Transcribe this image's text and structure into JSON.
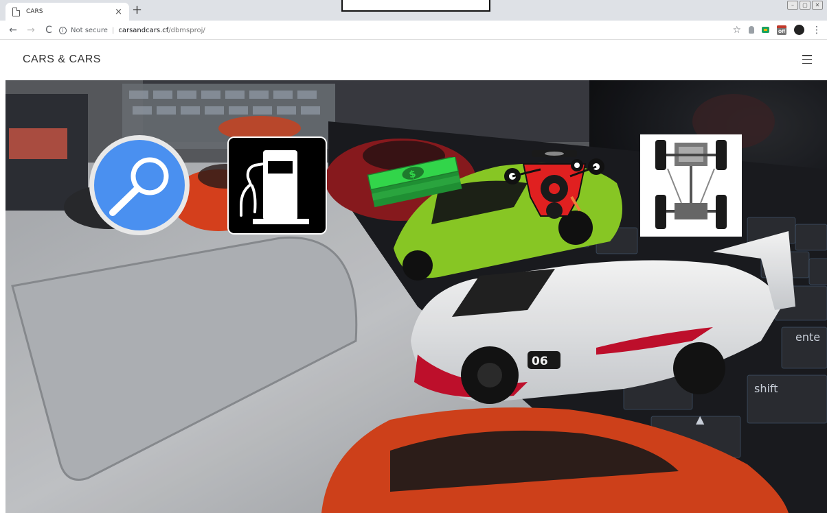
{
  "browser": {
    "tab_title": "CARS",
    "tab_close": "×",
    "new_tab": "+",
    "back": "←",
    "forward": "→",
    "reload": "C",
    "security_icon": "info-icon",
    "security_label": "Not secure",
    "url_host": "carsandcars.cf",
    "url_path": "/dbmsproj/",
    "bookmark_icon": "star-icon",
    "menu_icon": "⋮",
    "window_controls": [
      "–",
      "▢",
      "✕"
    ]
  },
  "site": {
    "brand": "CARS & CARS",
    "menu_icon": "hamburger-icon",
    "tiles": [
      {
        "name": "search",
        "icon": "magnifier-icon"
      },
      {
        "name": "fuel",
        "icon": "fuel-pump-icon"
      },
      {
        "name": "price",
        "icon": "money-stack-icon"
      },
      {
        "name": "engine",
        "icon": "engine-icon"
      },
      {
        "name": "chassis",
        "icon": "chassis-icon"
      }
    ],
    "colors": {
      "search_blue": "#4a90f0",
      "money_green": "#32d54a",
      "engine_red": "#e02020",
      "car_lime": "#8fd126",
      "car_orange": "#e0431e"
    },
    "background": "photo of toy sports cars on a laptop keyboard"
  }
}
